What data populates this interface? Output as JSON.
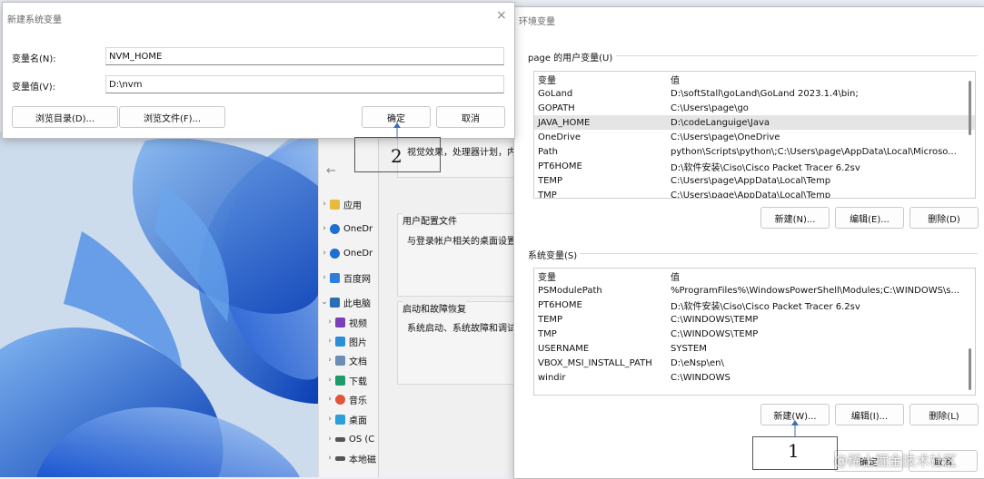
{
  "new_var_dialog": {
    "title": "新建系统变量",
    "name_label": "变量名(N):",
    "name_value": "NVM_HOME",
    "value_label": "变量值(V):",
    "value_value": "D:\\nvm",
    "browse_dir": "浏览目录(D)...",
    "browse_file": "浏览文件(F)...",
    "ok": "确定",
    "cancel": "取消",
    "close": "×"
  },
  "env_dialog": {
    "title": "环境变量",
    "user_group": "page 的用户变量(U)",
    "col_var": "变量",
    "col_val": "值",
    "user_vars": [
      {
        "name": "GoLand",
        "value": "D:\\softStall\\goLand\\GoLand 2023.1.4\\bin;"
      },
      {
        "name": "GOPATH",
        "value": "C:\\Users\\page\\go"
      },
      {
        "name": "JAVA_HOME",
        "value": "D:\\codeLanguige\\Java"
      },
      {
        "name": "OneDrive",
        "value": "C:\\Users\\page\\OneDrive"
      },
      {
        "name": "Path",
        "value": "python\\Scripts\\python\\;C:\\Users\\page\\AppData\\Local\\Microso..."
      },
      {
        "name": "PT6HOME",
        "value": "D:\\软件安装\\Ciso\\Cisco Packet Tracer 6.2sv"
      },
      {
        "name": "TEMP",
        "value": "C:\\Users\\page\\AppData\\Local\\Temp"
      },
      {
        "name": "TMP",
        "value": "C:\\Users\\page\\AppData\\Local\\Temp"
      }
    ],
    "user_new": "新建(N)...",
    "user_edit": "编辑(E)...",
    "user_delete": "删除(D)",
    "sys_group": "系统变量(S)",
    "sys_vars": [
      {
        "name": "PSModulePath",
        "value": "%ProgramFiles%\\WindowsPowerShell\\Modules;C:\\WINDOWS\\s..."
      },
      {
        "name": "PT6HOME",
        "value": "D:\\软件安装\\Ciso\\Cisco Packet Tracer 6.2sv"
      },
      {
        "name": "TEMP",
        "value": "C:\\WINDOWS\\TEMP"
      },
      {
        "name": "TMP",
        "value": "C:\\WINDOWS\\TEMP"
      },
      {
        "name": "USERNAME",
        "value": "SYSTEM"
      },
      {
        "name": "VBOX_MSI_INSTALL_PATH",
        "value": "D:\\eNsp\\en\\"
      },
      {
        "name": "windir",
        "value": "C:\\WINDOWS"
      }
    ],
    "sys_new": "新建(W)...",
    "sys_edit": "编辑(I)...",
    "sys_delete": "删除(L)",
    "ok": "确定",
    "cancel": "取消"
  },
  "sys_props": {
    "perf_text": "视觉效果，处理器计划，内",
    "profile_title": "用户配置文件",
    "profile_text": "与登录帐户相关的桌面设置",
    "startup_title": "启动和故障恢复",
    "startup_text": "系统启动、系统故障和调试"
  },
  "explorer": {
    "back": "←",
    "items": [
      {
        "label": "应用",
        "icon": "folder-icon",
        "color": "#e9b93a"
      },
      {
        "label": "OneDr",
        "icon": "cloud-icon",
        "color": "#1e6fd0"
      },
      {
        "label": "OneDr",
        "icon": "cloud-icon",
        "color": "#1e6fd0"
      },
      {
        "label": "百度网",
        "icon": "baidu-icon",
        "color": "#2f7de1"
      },
      {
        "label": "此电脑",
        "icon": "pc-icon",
        "color": "#2b6fb3"
      },
      {
        "label": "视频",
        "icon": "video-icon",
        "color": "#7b3fb8"
      },
      {
        "label": "图片",
        "icon": "picture-icon",
        "color": "#2b8fd6"
      },
      {
        "label": "文档",
        "icon": "document-icon",
        "color": "#6c8db5"
      },
      {
        "label": "下载",
        "icon": "download-icon",
        "color": "#1f9a6b"
      },
      {
        "label": "音乐",
        "icon": "music-icon",
        "color": "#e0553b"
      },
      {
        "label": "桌面",
        "icon": "desktop-icon",
        "color": "#2b9fd9"
      },
      {
        "label": "OS (C",
        "icon": "drive-icon",
        "color": "#555555"
      },
      {
        "label": "本地磁",
        "icon": "drive-icon",
        "color": "#555555"
      }
    ]
  },
  "annotations": {
    "one": "1",
    "two": "2"
  },
  "watermark": "@稀土掘金技术社区"
}
